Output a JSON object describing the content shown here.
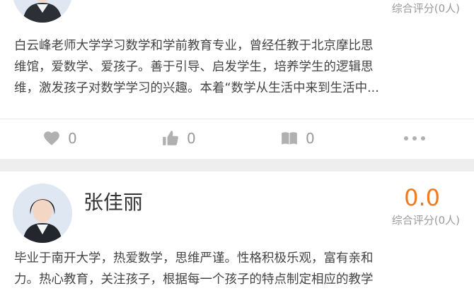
{
  "teachers": [
    {
      "name": "",
      "score": "",
      "score_label": "综合评分(0人)",
      "description": "白云峰老师大学学习数学和学前教育专业，曾经任教于北京摩比思\n维馆，爱数学、爱孩子。善于引导、启发学生，培养学生的逻辑思\n维，激发孩子对数学学习的兴趣。本着“数学从生活中来到生活中...",
      "favorites": "0",
      "likes": "0",
      "reads": "0"
    },
    {
      "name": "张佳丽",
      "score": "0.0",
      "score_label": "综合评分(0人)",
      "description": "毕业于南开大学，热爱数学，思维严谨。性格积极乐观，富有亲和\n力。热心教育，关注孩子，根据每一个孩子的特点制定相应的教学"
    }
  ],
  "colors": {
    "accent": "#f07a22",
    "muted": "#9a9a9a",
    "icon": "#b0b0b0",
    "separator": "#eeeeee"
  },
  "icons": [
    "heart-icon",
    "thumbs-up-icon",
    "book-icon",
    "more-icon"
  ]
}
